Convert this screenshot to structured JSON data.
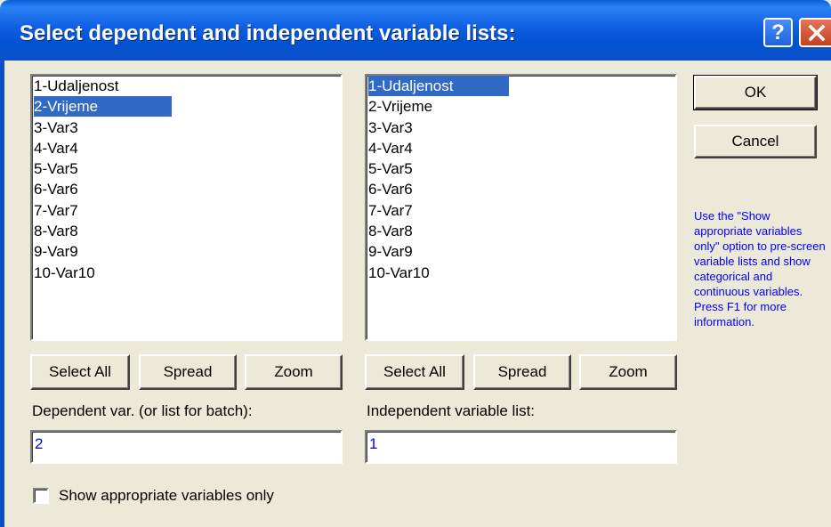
{
  "window": {
    "title": "Select dependent and independent variable lists:"
  },
  "left_list": {
    "items": [
      "1-Udaljenost",
      "2-Vrijeme",
      "3-Var3",
      "4-Var4",
      "5-Var5",
      "6-Var6",
      "7-Var7",
      "8-Var8",
      "9-Var9",
      "10-Var10"
    ],
    "selected": "2-Vrijeme"
  },
  "right_list": {
    "items": [
      "1-Udaljenost",
      "2-Vrijeme",
      "3-Var3",
      "4-Var4",
      "5-Var5",
      "6-Var6",
      "7-Var7",
      "8-Var8",
      "9-Var9",
      "10-Var10"
    ],
    "selected": "1-Udaljenost"
  },
  "left_buttons": {
    "select_all": "Select All",
    "spread": "Spread",
    "zoom": "Zoom"
  },
  "right_buttons": {
    "select_all": "Select All",
    "spread": "Spread",
    "zoom": "Zoom"
  },
  "dependent": {
    "label": "Dependent var. (or list for batch):",
    "value": "2"
  },
  "independent": {
    "label": "Independent variable list:",
    "value": "1"
  },
  "ok_label": "OK",
  "cancel_label": "Cancel",
  "help_note": "Use the \"Show appropriate variables only\" option to pre-screen variable lists and show categorical and continuous variables. Press F1 for more information.",
  "checkbox": {
    "label": "Show appropriate variables only",
    "checked": false
  },
  "colors": {
    "title_bar": "#0a50c8",
    "selection": "#316AC5",
    "note_text": "#0000ff",
    "dialog_bg": "#ECE9D8"
  }
}
